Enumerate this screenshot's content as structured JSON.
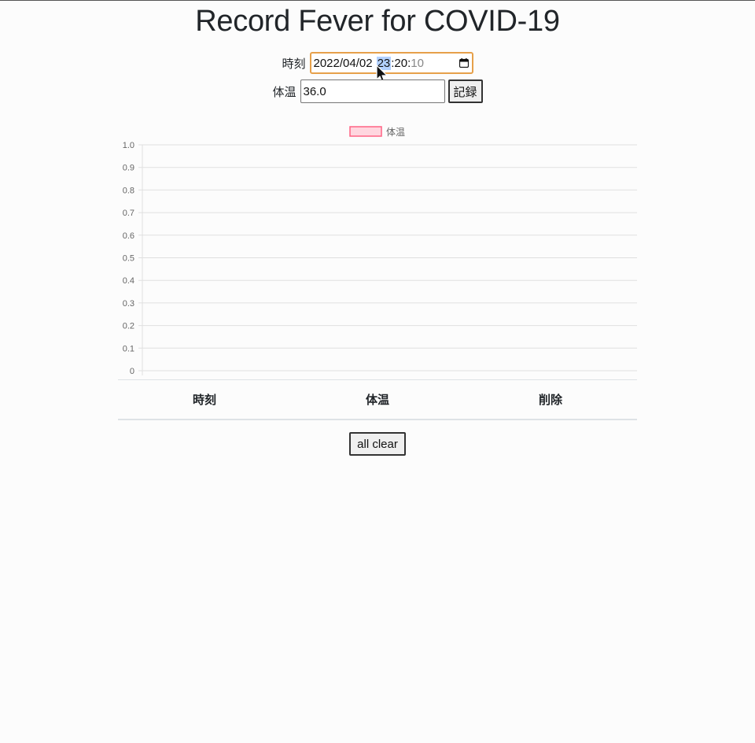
{
  "title": "Record Fever for COVID-19",
  "form": {
    "time_label": "時刻",
    "time_value_date": "2022/04/02",
    "time_value_hour": "23",
    "time_value_rest": ":20:",
    "time_value_sec": "10",
    "temp_label": "体温",
    "temp_value": "36.0",
    "record_button": "記録"
  },
  "chart_data": {
    "type": "line",
    "title": "",
    "xlabel": "",
    "ylabel": "",
    "legend": [
      "体温"
    ],
    "legend_position": "top",
    "series": [
      {
        "name": "体温",
        "color": "#ff6384",
        "fill": "rgba(255,99,132,0.2)",
        "values": []
      }
    ],
    "categories": [],
    "ylim": [
      0,
      1.0
    ],
    "yticks": [
      "1.0",
      "0.9",
      "0.8",
      "0.7",
      "0.6",
      "0.5",
      "0.4",
      "0.3",
      "0.2",
      "0.1",
      "0"
    ],
    "grid": true
  },
  "table": {
    "headers": [
      "時刻",
      "体温",
      "削除"
    ],
    "rows": []
  },
  "clear_button": "all clear",
  "colors": {
    "focus_border": "#e6a04a",
    "selection": "#b3d1ff",
    "legend_fill": "#ffd6df",
    "legend_stroke": "#ff6384",
    "grid": "#e0e0e0"
  }
}
